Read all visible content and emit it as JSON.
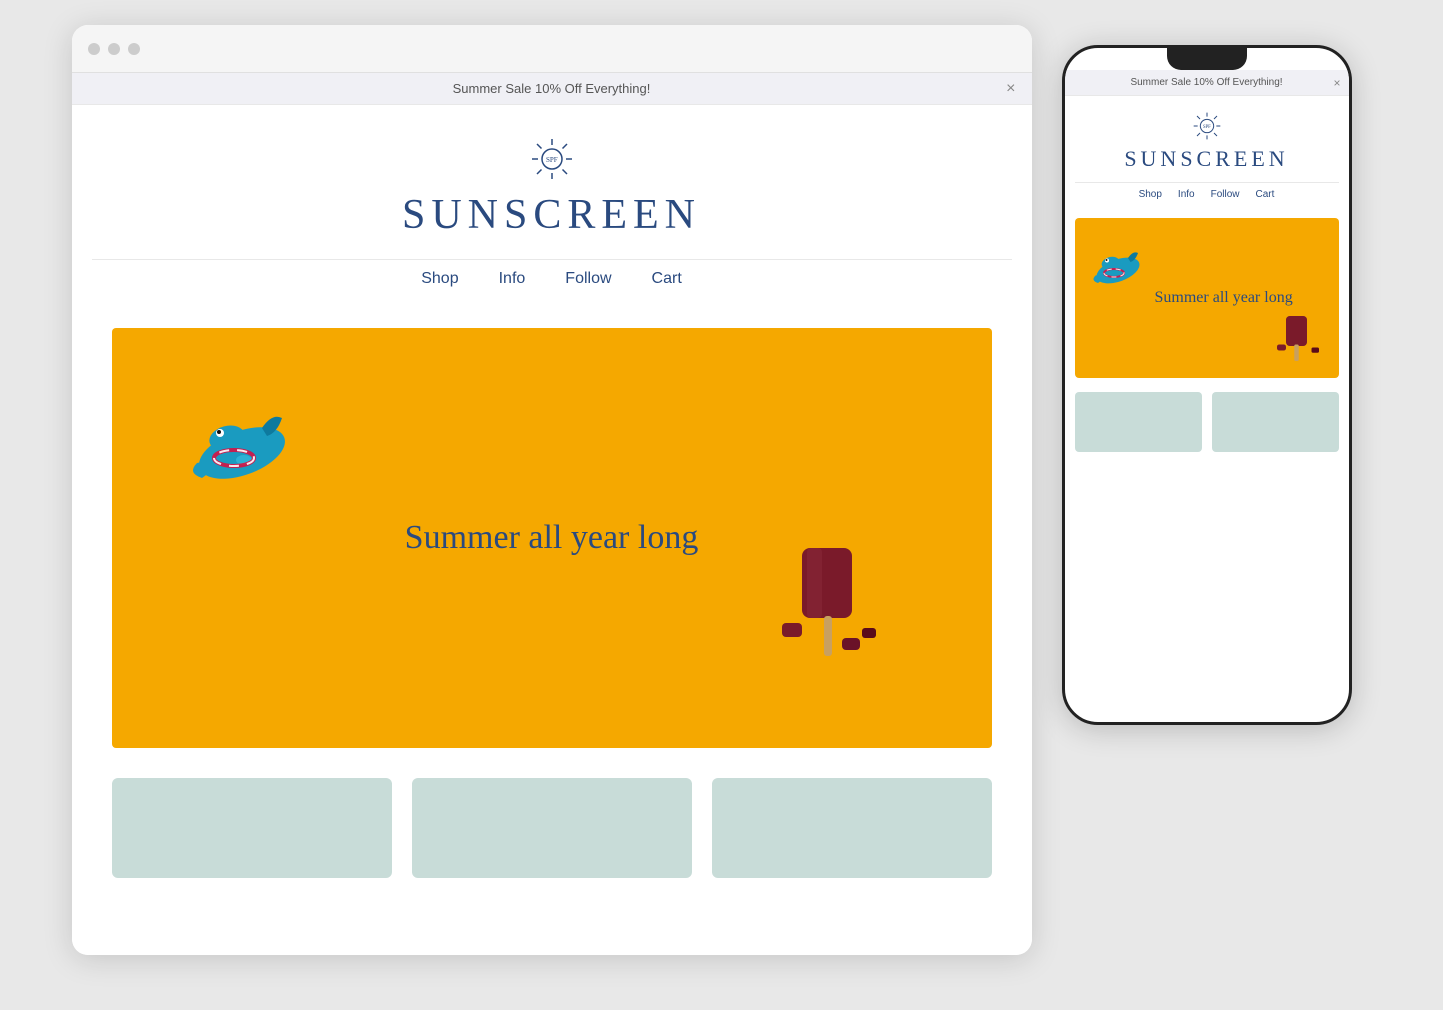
{
  "browser": {
    "announcement": {
      "text": "Summer Sale 10% Off Everything!",
      "close_label": "×"
    },
    "logo": {
      "text": "SUNSCREEN"
    },
    "nav": {
      "items": [
        {
          "label": "Shop"
        },
        {
          "label": "Info"
        },
        {
          "label": "Follow"
        },
        {
          "label": "Cart"
        }
      ]
    },
    "hero": {
      "tagline": "Summer all year long"
    },
    "product_cards": [
      {
        "id": "card-1"
      },
      {
        "id": "card-2"
      },
      {
        "id": "card-3"
      }
    ]
  },
  "phone": {
    "announcement": {
      "text": "Summer Sale 10% Off Everything!",
      "close_label": "×"
    },
    "logo": {
      "text": "SUNSCREEN"
    },
    "nav": {
      "items": [
        {
          "label": "Shop"
        },
        {
          "label": "Info"
        },
        {
          "label": "Follow"
        },
        {
          "label": "Cart"
        }
      ]
    },
    "hero": {
      "tagline": "Summer all year long"
    }
  },
  "colors": {
    "brand_blue": "#2a4a7f",
    "hero_yellow": "#f5a800",
    "card_teal": "#c8dcd8"
  }
}
